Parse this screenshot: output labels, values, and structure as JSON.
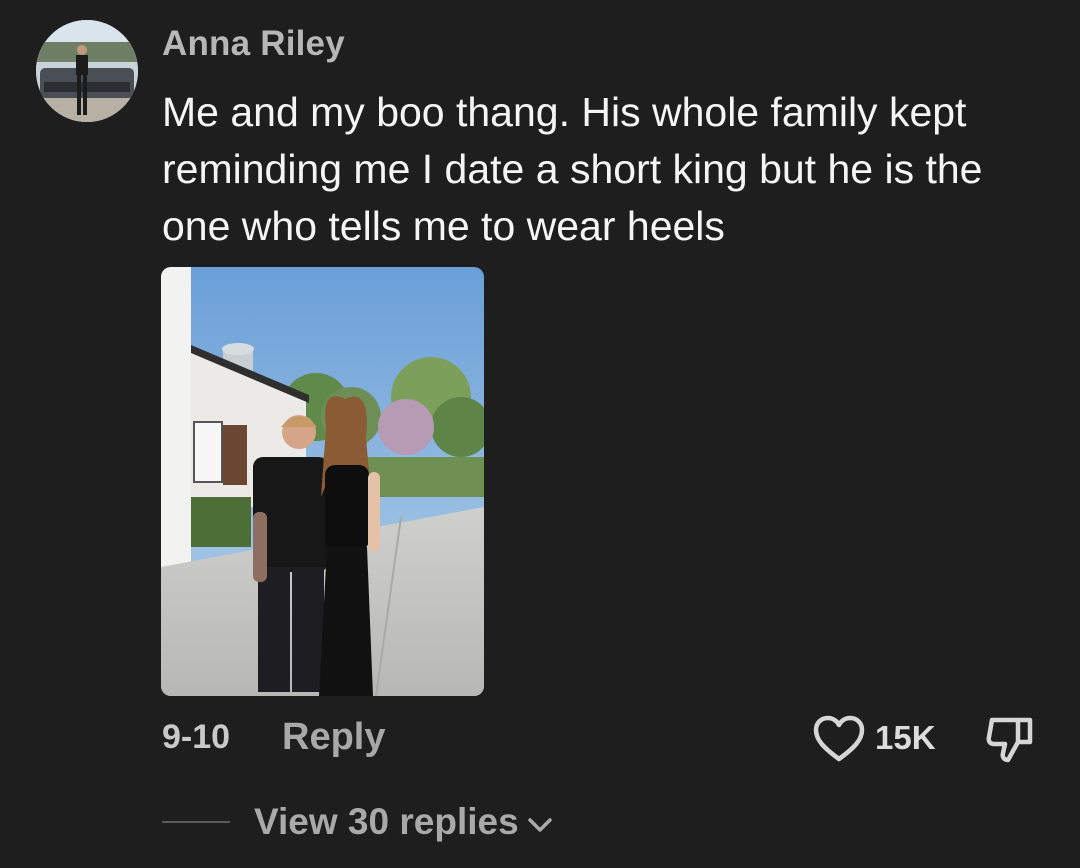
{
  "comment": {
    "username": "Anna Riley",
    "text": "Me and my boo thang. His whole family kept reminding me I date a short king but he is the one who tells me to wear heels",
    "date": "9-10",
    "reply_label": "Reply",
    "like_count": "15K",
    "view_replies_label": "View 30 replies"
  },
  "icons": {
    "like": "heart-outline-icon",
    "dislike": "thumbs-down-icon",
    "expand": "chevron-down-icon"
  },
  "colors": {
    "background": "#1e1e1e",
    "username": "#b7b7b7",
    "text": "#f5f5f5",
    "secondary": "#a8a8a8"
  }
}
